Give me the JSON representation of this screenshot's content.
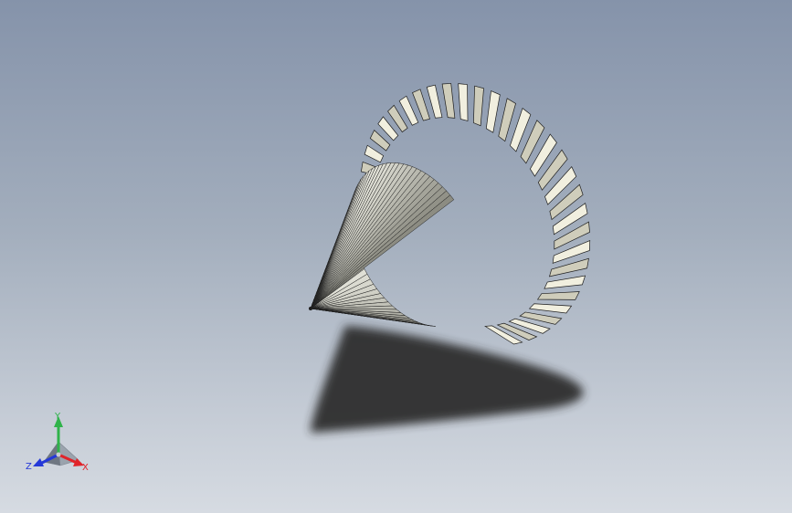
{
  "viewport": {
    "model": "spiral-bevel-gear",
    "colors": {
      "background_top": "#8593aa",
      "background_bottom": "#d6dbe2",
      "tooth_face": "#f1efdf",
      "tooth_shade": "#cfcdbb",
      "cone_light": "#f3f2ea",
      "cone_dark": "#8d8d86",
      "edge": "#1e1e1e",
      "shadow": "#2d2d2d"
    }
  },
  "triad": {
    "x_label": "X",
    "y_label": "Y",
    "z_label": "Z",
    "colors": {
      "x": "#e0242a",
      "y": "#2fb34a",
      "z": "#2438d8"
    }
  }
}
